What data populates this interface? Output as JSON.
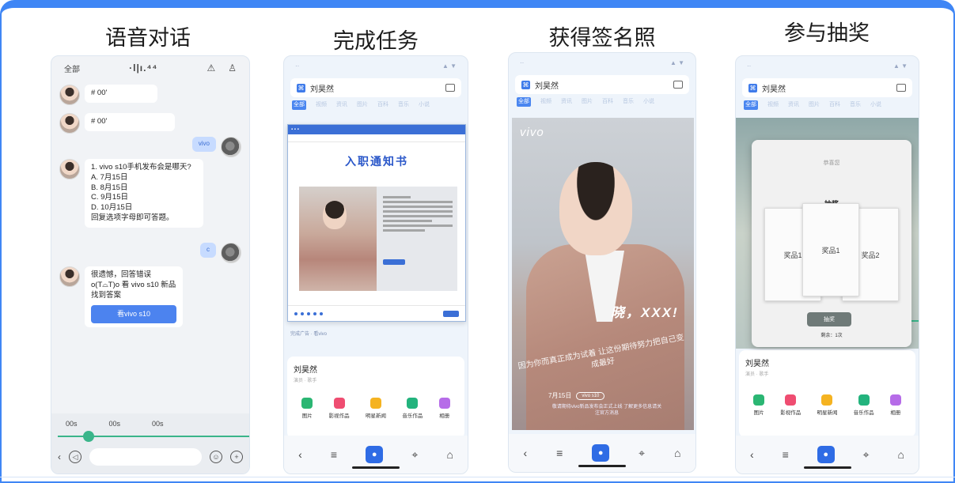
{
  "panels": [
    {
      "title": "语音对话"
    },
    {
      "title": "完成任务"
    },
    {
      "title": "获得签名照"
    },
    {
      "title": "参与抽奖"
    }
  ],
  "phone1": {
    "status_left": "全部",
    "status_center": "·l|ı.⁴⁴",
    "msg1": "# 00'",
    "msg2": "# 00'",
    "user_bubble1": "vivo",
    "quiz": [
      "1. vivo s10手机发布会是哪天?",
      "A. 7月15日",
      "B. 8月15日",
      "C. 9月15日",
      "D. 10月15日",
      "回复选项字母即可答题。"
    ],
    "user_bubble2": "c",
    "reply_text": "很遗憾，回答错误 o(T⌓T)o 看 vivo s10 新品找到答案",
    "reply_button": "看vivo s10",
    "tabs": [
      "00s",
      "00s",
      "00s"
    ]
  },
  "phone2": {
    "search_text": "刘昊然",
    "tabs": [
      "全部",
      "视频",
      "资讯",
      "图片",
      "百科",
      "音乐",
      "小说"
    ],
    "doc_title": "入职通知书",
    "caption": "完成广告 · 看vivo",
    "profile_name": "刘昊然",
    "profile_sub": "演员 · 歌手",
    "apps": [
      "图片",
      "影视作品",
      "明星新闻",
      "音乐作品",
      "相册"
    ]
  },
  "phone3": {
    "search_text": "刘昊然",
    "tabs": [
      "全部",
      "视频",
      "资讯",
      "图片",
      "百科",
      "音乐",
      "小说"
    ],
    "brand": "vivo",
    "sign_text": "晓，XXX!",
    "slogan": "因为你而真正成为试着 让这份期待努力把自己变成最好",
    "date_text": "7月15日",
    "date_pill": "vivo s10",
    "fineprint": "敬请期待vivo新品发布会正式上线 了解更多信息请关注官方消息"
  },
  "phone4": {
    "search_text": "刘昊然",
    "tabs": [
      "全部",
      "视频",
      "资讯",
      "图片",
      "百科",
      "音乐",
      "小说"
    ],
    "modal_title": "恭喜您",
    "modal_sub": "抽奖",
    "prizes": [
      "奖品1",
      "奖品1",
      "奖品2"
    ],
    "draw_button": "抽奖",
    "draw_count": "剩余：1次",
    "profile_name": "刘昊然",
    "profile_sub": "演员 · 歌手",
    "apps": [
      "图片",
      "影视作品",
      "明星新闻",
      "音乐作品",
      "相册"
    ]
  },
  "colors": {
    "accent": "#3f86f5",
    "mic": "#2f6ce5",
    "green": "#3ab58a",
    "app_icons": [
      "#2bb673",
      "#ef4d71",
      "#f5b321",
      "#23b37d",
      "#b66ce8"
    ]
  },
  "icons": {
    "nav": [
      "chevron-left-icon",
      "menu-icon",
      "mic-icon",
      "compass-icon",
      "home-icon"
    ]
  }
}
